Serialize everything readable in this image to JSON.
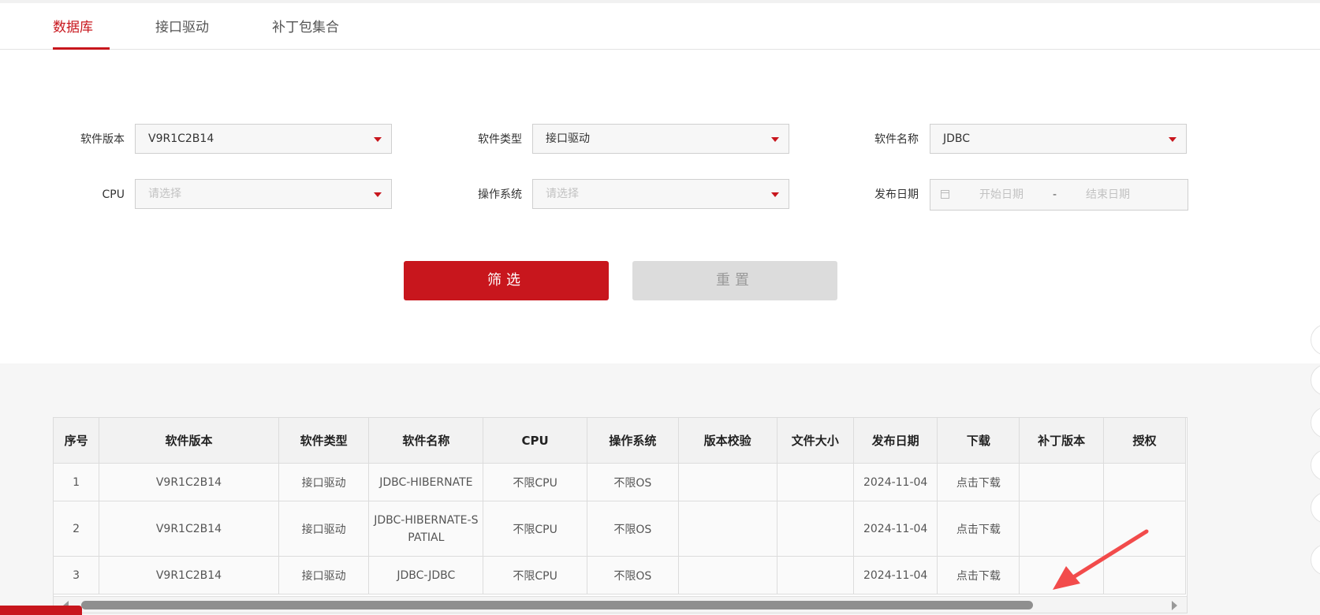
{
  "tabs": [
    {
      "label": "数据库",
      "active": true
    },
    {
      "label": "接口驱动",
      "active": false
    },
    {
      "label": "补丁包集合",
      "active": false
    }
  ],
  "filters": {
    "software_version": {
      "label": "软件版本",
      "value": "V9R1C2B14"
    },
    "software_type": {
      "label": "软件类型",
      "value": "接口驱动"
    },
    "software_name": {
      "label": "软件名称",
      "value": "JDBC"
    },
    "cpu": {
      "label": "CPU",
      "placeholder": "请选择"
    },
    "os": {
      "label": "操作系统",
      "placeholder": "请选择"
    },
    "release_date": {
      "label": "发布日期",
      "start_placeholder": "开始日期",
      "separator": "-",
      "end_placeholder": "结束日期"
    }
  },
  "buttons": {
    "filter": "筛选",
    "reset": "重置"
  },
  "table": {
    "headers": [
      "序号",
      "软件版本",
      "软件类型",
      "软件名称",
      "CPU",
      "操作系统",
      "版本校验",
      "文件大小",
      "发布日期",
      "下载",
      "补丁版本",
      "授权"
    ],
    "rows": [
      {
        "no": "1",
        "version": "V9R1C2B14",
        "type": "接口驱动",
        "name": "JDBC-HIBERNATE",
        "cpu": "不限CPU",
        "os": "不限OS",
        "checksum": "",
        "size": "",
        "date": "2024-11-04",
        "download": "点击下载",
        "patch": "",
        "auth": ""
      },
      {
        "no": "2",
        "version": "V9R1C2B14",
        "type": "接口驱动",
        "name": "JDBC-HIBERNATE-SPATIAL",
        "cpu": "不限CPU",
        "os": "不限OS",
        "checksum": "",
        "size": "",
        "date": "2024-11-04",
        "download": "点击下载",
        "patch": "",
        "auth": ""
      },
      {
        "no": "3",
        "version": "V9R1C2B14",
        "type": "接口驱动",
        "name": "JDBC-JDBC",
        "cpu": "不限CPU",
        "os": "不限OS",
        "checksum": "",
        "size": "",
        "date": "2024-11-04",
        "download": "点击下载",
        "patch": "",
        "auth": ""
      }
    ]
  },
  "colors": {
    "accent": "#c8161d",
    "annotation_arrow": "#f24b4b"
  },
  "icons": {
    "dropdown": "caret-down-icon",
    "calendar": "calendar-icon"
  }
}
